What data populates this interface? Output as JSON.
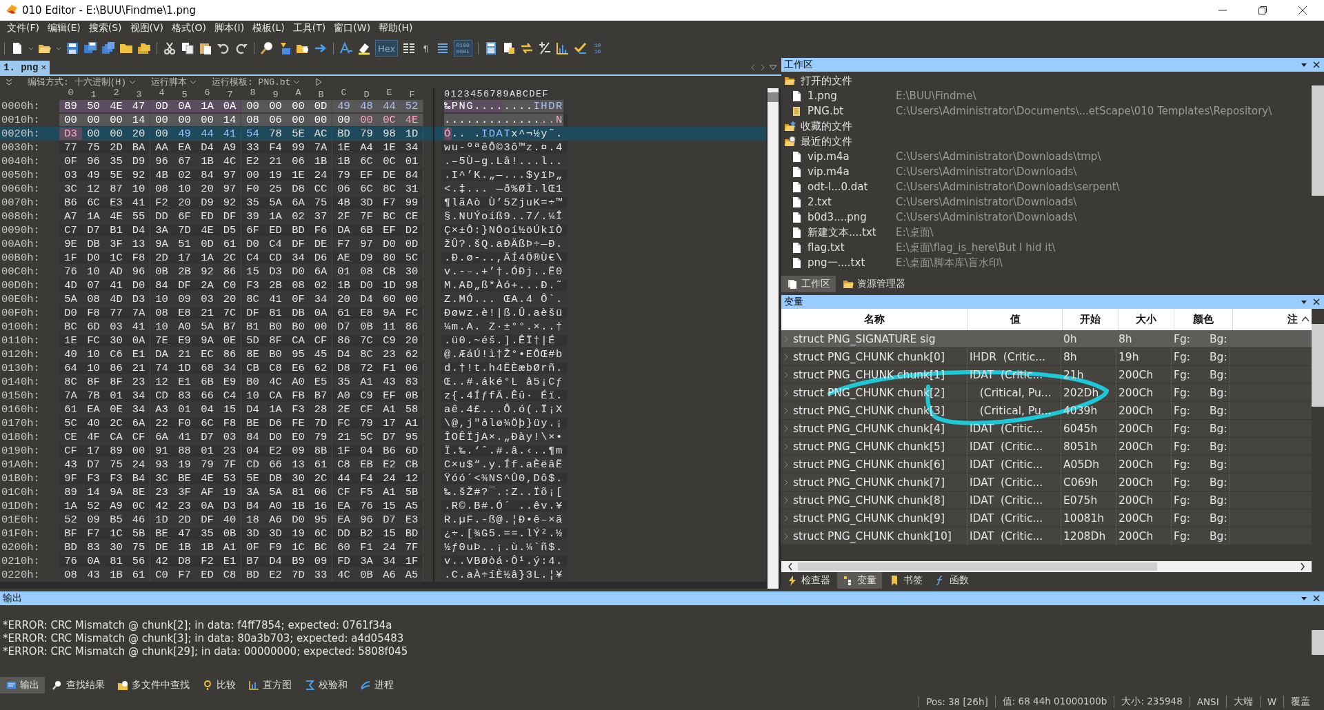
{
  "window": {
    "title": "010 Editor - E:\\BUU\\Findme\\1.png"
  },
  "menu": [
    "文件(F)",
    "编辑(E)",
    "搜索(S)",
    "视图(V)",
    "格式(O)",
    "脚本(I)",
    "模板(L)",
    "工具(T)",
    "窗口(W)",
    "帮助(H)"
  ],
  "toolbar": [
    {
      "kind": "sep"
    },
    {
      "kind": "new"
    },
    {
      "kind": "open"
    },
    {
      "kind": "save"
    },
    {
      "kind": "saveas"
    },
    {
      "kind": "saveall"
    },
    {
      "kind": "folder"
    },
    {
      "kind": "folders"
    },
    {
      "kind": "sep"
    },
    {
      "kind": "cut"
    },
    {
      "kind": "copy"
    },
    {
      "kind": "paste"
    },
    {
      "kind": "undo"
    },
    {
      "kind": "redo"
    },
    {
      "kind": "sep"
    },
    {
      "kind": "find"
    },
    {
      "kind": "replace"
    },
    {
      "kind": "findfiles"
    },
    {
      "kind": "goto"
    },
    {
      "kind": "sep"
    },
    {
      "kind": "font"
    },
    {
      "kind": "highlight"
    },
    {
      "kind": "text",
      "label": "Hex",
      "pressed": true
    },
    {
      "kind": "columns"
    },
    {
      "kind": "text",
      "label": "¶",
      "pressed": false
    },
    {
      "kind": "lines"
    },
    {
      "kind": "binary",
      "label": "0100 0001",
      "pressed": true
    },
    {
      "kind": "sep"
    },
    {
      "kind": "calc"
    },
    {
      "kind": "template"
    },
    {
      "kind": "swap"
    },
    {
      "kind": "plusminus"
    },
    {
      "kind": "histogram"
    },
    {
      "kind": "check"
    },
    {
      "kind": "base",
      "label": "10 16"
    }
  ],
  "editor": {
    "tab": {
      "label": "1. png",
      "close": "×",
      "selected": true
    },
    "options": [
      {
        "kind": "dropdown",
        "label": "编辑方式: 十六进制(H)"
      },
      {
        "kind": "dropdown",
        "label": "运行脚本"
      },
      {
        "kind": "dropdown",
        "label": "运行模板: PNG.bt"
      },
      {
        "kind": "play"
      }
    ],
    "columns": [
      "0",
      "1",
      "2",
      "3",
      "4",
      "5",
      "6",
      "7",
      "8",
      "9",
      "A",
      "B",
      "C",
      "D",
      "E",
      "F"
    ],
    "ascii_header": "0123456789ABCDEF",
    "rows": [
      {
        "offset": "0000h:",
        "cells": [
          {
            "text": "89",
            "kind": "sig"
          },
          {
            "text": "50",
            "kind": "sig"
          },
          {
            "text": "4E",
            "kind": "sig"
          },
          {
            "text": "47",
            "kind": "sig"
          },
          {
            "text": "0D",
            "kind": "sig"
          },
          {
            "text": "0A",
            "kind": "sig"
          },
          {
            "text": "1A",
            "kind": "sig"
          },
          {
            "text": "0A",
            "kind": "sig"
          },
          {
            "text": "00",
            "kind": "hdr"
          },
          {
            "text": "00",
            "kind": "hdr"
          },
          {
            "text": "00",
            "kind": "hdr"
          },
          {
            "text": "0D",
            "kind": "hdr"
          },
          {
            "text": "49",
            "kind": "type"
          },
          {
            "text": "48",
            "kind": "type"
          },
          {
            "text": "44",
            "kind": "type"
          },
          {
            "text": "52",
            "kind": "type"
          }
        ],
        "ascii": "‰PNG........IHDR",
        "selected": false
      },
      {
        "offset": "0010h:",
        "cells": [
          {
            "text": "00",
            "kind": "hdr"
          },
          {
            "text": "00",
            "kind": "hdr"
          },
          {
            "text": "00",
            "kind": "hdr"
          },
          {
            "text": "14",
            "kind": "hdr"
          },
          {
            "text": "00",
            "kind": "hdr"
          },
          {
            "text": "00",
            "kind": "hdr"
          },
          {
            "text": "00",
            "kind": "hdr"
          },
          {
            "text": "14",
            "kind": "hdr"
          },
          {
            "text": "08",
            "kind": "hdr"
          },
          {
            "text": "06",
            "kind": "hdr"
          },
          {
            "text": "00",
            "kind": "hdr"
          },
          {
            "text": "00",
            "kind": "hdr"
          },
          {
            "text": "00",
            "kind": "hdr"
          },
          {
            "text": "00",
            "kind": "crc"
          },
          {
            "text": "0C",
            "kind": "crc"
          },
          {
            "text": "4E",
            "kind": "crc"
          }
        ],
        "ascii": "...............N",
        "selected": false
      },
      {
        "offset": "0020h:",
        "cells": [
          {
            "text": "D3",
            "kind": "crc"
          },
          {
            "text": "00",
            "kind": "data"
          },
          {
            "text": "00",
            "kind": "data"
          },
          {
            "text": "20",
            "kind": "data"
          },
          {
            "text": "00",
            "kind": "data"
          },
          {
            "text": "49",
            "kind": "type"
          },
          {
            "text": "44",
            "kind": "type"
          },
          {
            "text": "41",
            "kind": "type"
          },
          {
            "text": "54",
            "kind": "type"
          },
          {
            "text": "78",
            "kind": "data"
          },
          {
            "text": "5E",
            "kind": "data"
          },
          {
            "text": "AC",
            "kind": "data"
          },
          {
            "text": "BD",
            "kind": "data"
          },
          {
            "text": "79",
            "kind": "data"
          },
          {
            "text": "98",
            "kind": "data"
          },
          {
            "text": "1D",
            "kind": "data"
          }
        ],
        "ascii": "Ó.. .IDATx^¬½y˜.",
        "selected": true
      },
      {
        "offset": "0030h:",
        "bytes": "77 75 2D BA AA EA D4 A9 33 F4 99 7A 1E A4 1E 34",
        "ascii": "wu-ºªêÔ©3ô™z.¤.4",
        "selected": false
      },
      {
        "offset": "0040h:",
        "bytes": "0F 96 35 D9 96 67 1B 4C E2 21 06 1B 1B 6C 0C 01",
        "ascii": ".–5Ù–g.Lâ!...l..",
        "selected": false
      },
      {
        "offset": "0050h:",
        "bytes": "03 49 5E 92 4B 02 84 97 00 19 1E 24 79 EF DE 84",
        "ascii": ".I^’K.„—...$yïÞ„",
        "selected": false
      },
      {
        "offset": "0060h:",
        "bytes": "3C 12 87 10 08 10 20 97 F0 25 D8 CC 06 6C 8C 31",
        "ascii": "<.‡... —ð%ØÌ.lŒ1",
        "selected": false
      },
      {
        "offset": "0070h:",
        "bytes": "B6 6C E3 41 F2 20 D9 92 35 5A 6A 75 4B 3D F7 99",
        "ascii": "¶lãAò Ù’5ZjuK=÷™",
        "selected": false
      },
      {
        "offset": "0080h:",
        "bytes": "A7 1A 4E 55 DD 6F ED DF 39 1A 02 37 2F 7F BC CE",
        "ascii": "§.NUÝoíß9..7/.¼Î",
        "selected": false
      },
      {
        "offset": "0090h:",
        "bytes": "C7 D7 B1 D4 3A 7D 4E D5 6F ED BD F6 DA 6B EF D2",
        "ascii": "Ç×±Ô:}NÕoí½öÚkïÒ",
        "selected": false
      },
      {
        "offset": "00A0h:",
        "bytes": "9E DB 3F 13 9A 51 0D 61 D0 C4 DF DE F7 97 D0 0D",
        "ascii": "žÛ?.šQ.aÐÄßÞ÷—Ð.",
        "selected": false
      },
      {
        "offset": "00B0h:",
        "bytes": "1F D0 1C F8 2D 17 1A 2C C4 CD 34 D6 AE D9 80 5C",
        "ascii": ".Ð.ø-..,ÄÍ4Ö®Ù€\\",
        "selected": false
      },
      {
        "offset": "00C0h:",
        "bytes": "76 10 AD 96 0B 2B 92 86 15 D3 D0 6A 01 08 CB 30",
        "ascii": "v.-–.+’†.ÓÐj..Ë0",
        "selected": false
      },
      {
        "offset": "00D0h:",
        "bytes": "4D 07 41 D0 84 DF 2A C0 F3 2B 08 02 1B D0 1D 98",
        "ascii": "M.AÐ„ß*Àó+...Ð.˜",
        "selected": false
      },
      {
        "offset": "00E0h:",
        "bytes": "5A 08 4D D3 10 09 03 20 8C 41 0F 34 20 D4 60 00",
        "ascii": "Z.MÓ... ŒA.4 Ô`.",
        "selected": false
      },
      {
        "offset": "00F0h:",
        "bytes": "D0 F8 77 7A 08 E8 21 7C DF 81 DB 0A 61 E8 9A FC",
        "ascii": "Ðøwz.è!|ß.Û.aèšü",
        "selected": false
      },
      {
        "offset": "0100h:",
        "bytes": "BC 6D 03 41 10 A0 5A B7 B1 B0 B0 00 D7 0B 11 86",
        "ascii": "¼m.A. Z·±°°.×..†",
        "selected": false
      },
      {
        "offset": "0110h:",
        "bytes": "1E FC 30 0A 7E E9 9A 0E 5D 8F CA CF 86 7C C9 20",
        "ascii": ".ü0.~éš.].ÊÏ†|É ",
        "selected": false
      },
      {
        "offset": "0120h:",
        "bytes": "40 10 C6 E1 DA 21 EC 86 8E B0 95 45 D4 8C 23 62",
        "ascii": "@.ÆáÚ!ì†Ž°•EÔŒ#b",
        "selected": false
      },
      {
        "offset": "0130h:",
        "bytes": "64 10 86 21 74 1D 68 34 CB C8 E6 62 D8 72 F1 06",
        "ascii": "d.†!t.h4ËÈæbØrñ.",
        "selected": false
      },
      {
        "offset": "0140h:",
        "bytes": "8C 8F 8F 23 12 E1 6B E9 B0 4C A0 E5 35 A1 43 83",
        "ascii": "Œ..#.áké°L å5¡Cƒ",
        "selected": false
      },
      {
        "offset": "0150h:",
        "bytes": "7A 7B 01 34 CD 83 66 C4 10 CA FB B7 A0 C9 EF 0B",
        "ascii": "z{.4ÍƒfÄ.Êû· Éï.",
        "selected": false
      },
      {
        "offset": "0160h:",
        "bytes": "61 EA 0E 34 A3 01 04 15 D4 1A F3 28 2E CF A1 58",
        "ascii": "aê.4£...Ô.ó(.Ï¡X",
        "selected": false
      },
      {
        "offset": "0170h:",
        "bytes": "5C 40 2C 6A 22 F0 6C F8 BE D6 FE 7D FC 79 17 A1",
        "ascii": "\\@,j\"ðlø¾Öþ}üy.¡",
        "selected": false
      },
      {
        "offset": "0180h:",
        "bytes": "CE 4F CA CF 6A 41 D7 03 84 D0 E0 79 21 5C D7 95",
        "ascii": "ÎOÊÏjA×.„Ðày!\\×•",
        "selected": false
      },
      {
        "offset": "0190h:",
        "bytes": "CF 17 89 00 91 88 01 23 04 E2 09 8B 1F 04 B6 6D",
        "ascii": "Ï.‰.‘ˆ.#.â.‹..¶m",
        "selected": false
      },
      {
        "offset": "01A0h:",
        "bytes": "43 D7 75 24 93 19 79 7F CD 66 13 61 C8 EB E2 CB",
        "ascii": "C×u$“.y.Íf.aÈëâË",
        "selected": false
      },
      {
        "offset": "01B0h:",
        "bytes": "9F F3 F3 B4 3C BE 4E 53 5E DB 30 2C 44 F4 24 12",
        "ascii": "Ÿóó´<¾NS^Û0,Dô$.",
        "selected": false
      },
      {
        "offset": "01C0h:",
        "bytes": "89 14 9A 8E 23 3F AF 19 3A 5A 81 06 CF F5 A1 5B",
        "ascii": "‰.šŽ#?¯.:Z..Ïõ¡[",
        "selected": false
      },
      {
        "offset": "01D0h:",
        "bytes": "1A 52 A9 0C 42 23 0A D3 B4 A0 1B 16 EA 76 15 A5",
        "ascii": ".R©.B#.Ó´ ..êv.¥",
        "selected": false
      },
      {
        "offset": "01E0h:",
        "bytes": "52 09 B5 46 1D 2D DF 40 18 A6 D0 95 EA 96 D7 E3",
        "ascii": "R.µF.-ß@.¦Ð•ê–×ã",
        "selected": false
      },
      {
        "offset": "01F0h:",
        "bytes": "BF F7 1C 5B BE 47 35 0B 3D 3D 19 6C DD B2 15 BD",
        "ascii": "¿÷.[¾G5.==.lÝ².½",
        "selected": false
      },
      {
        "offset": "0200h:",
        "bytes": "BD 83 30 75 DE 1B 1B A1 0F F9 1C BC 60 F1 24 7F",
        "ascii": "½ƒ0uÞ..¡.ù.¼`ñ$.",
        "selected": false
      },
      {
        "offset": "0210h:",
        "bytes": "76 0A 81 56 42 D8 F2 E1 B7 D4 B9 09 FD 3A 34 1F",
        "ascii": "v..VBØòá·Ô¹.ý:4.",
        "selected": false
      },
      {
        "offset": "0220h:",
        "bytes": "08 43 1B 61 C0 F7 ED C8 BD E2 7D 33 4C 0B A6 A5",
        "ascii": ".C.aÀ÷íÈ½â}3L.¦¥",
        "selected": false
      }
    ]
  },
  "workspace": {
    "title": "工作区",
    "tree": [
      {
        "label": "打开的文件",
        "kind": "open",
        "children": [
          {
            "label": "1.png",
            "path": "E:\\BUU\\Findme\\",
            "kind": "file"
          },
          {
            "label": "PNG.bt",
            "path": "C:\\Users\\Administrator\\Documents\\...etScape\\010 Templates\\Repository\\",
            "kind": "template"
          }
        ]
      },
      {
        "label": "收藏的文件",
        "kind": "favorites"
      },
      {
        "label": "最近的文件",
        "kind": "recent",
        "children": [
          {
            "label": "vip.m4a",
            "path": "C:\\Users\\Administrator\\Downloads\\tmp\\",
            "kind": "file"
          },
          {
            "label": "vip.m4a",
            "path": "C:\\Users\\Administrator\\Downloads\\",
            "kind": "file"
          },
          {
            "label": "odt-l...0.dat",
            "path": "C:\\Users\\Administrator\\Downloads\\serpent\\",
            "kind": "file"
          },
          {
            "label": "2.txt",
            "path": "C:\\Users\\Administrator\\Downloads\\",
            "kind": "file"
          },
          {
            "label": "b0d3....png",
            "path": "C:\\Users\\Administrator\\Downloads\\",
            "kind": "file"
          },
          {
            "label": "新建文本....txt",
            "path": "E:\\桌面\\",
            "kind": "file"
          },
          {
            "label": "flag.txt",
            "path": "E:\\桌面\\flag_is_here\\But I hid it\\",
            "kind": "file"
          },
          {
            "label": "png一....txt",
            "path": "E:\\桌面\\脚本库\\盲水印\\",
            "kind": "file"
          }
        ]
      }
    ],
    "tabs": [
      {
        "label": "工作区",
        "kind": "workspace",
        "selected": true
      },
      {
        "label": "资源管理器",
        "kind": "explorer",
        "selected": false
      }
    ]
  },
  "variables": {
    "title": "变量",
    "columns": [
      "名称",
      "值",
      "开始",
      "大小",
      "颜色",
      "注"
    ],
    "rows": [
      {
        "name": "struct PNG_SIGNATURE sig",
        "start": "0h",
        "size": "8h",
        "fg": "Fg:",
        "bg": "Bg:",
        "selected": true
      },
      {
        "name": "struct PNG_CHUNK chunk[0]",
        "value": "IHDR  (Critic...",
        "start": "8h",
        "size": "19h",
        "fg": "Fg:",
        "bg": "Bg:",
        "selected": false
      },
      {
        "name": "struct PNG_CHUNK chunk[1]",
        "value": "IDAT  (Critic...",
        "start": "21h",
        "size": "200Ch",
        "fg": "Fg:",
        "bg": "Bg:",
        "selected": false
      },
      {
        "name": "struct PNG_CHUNK chunk[2]",
        "value": "   (Critical, Pu...",
        "start": "202Dh",
        "size": "200Ch",
        "fg": "Fg:",
        "bg": "Bg:",
        "selected": false
      },
      {
        "name": "struct PNG_CHUNK chunk[3]",
        "value": "   (Critical, Pu...",
        "start": "4039h",
        "size": "200Ch",
        "fg": "Fg:",
        "bg": "Bg:",
        "selected": false
      },
      {
        "name": "struct PNG_CHUNK chunk[4]",
        "value": "IDAT  (Critic...",
        "start": "6045h",
        "size": "200Ch",
        "fg": "Fg:",
        "bg": "Bg:",
        "selected": false
      },
      {
        "name": "struct PNG_CHUNK chunk[5]",
        "value": "IDAT  (Critic...",
        "start": "8051h",
        "size": "200Ch",
        "fg": "Fg:",
        "bg": "Bg:",
        "selected": false
      },
      {
        "name": "struct PNG_CHUNK chunk[6]",
        "value": "IDAT  (Critic...",
        "start": "A05Dh",
        "size": "200Ch",
        "fg": "Fg:",
        "bg": "Bg:",
        "selected": false
      },
      {
        "name": "struct PNG_CHUNK chunk[7]",
        "value": "IDAT  (Critic...",
        "start": "C069h",
        "size": "200Ch",
        "fg": "Fg:",
        "bg": "Bg:",
        "selected": false
      },
      {
        "name": "struct PNG_CHUNK chunk[8]",
        "value": "IDAT  (Critic...",
        "start": "E075h",
        "size": "200Ch",
        "fg": "Fg:",
        "bg": "Bg:",
        "selected": false
      },
      {
        "name": "struct PNG_CHUNK chunk[9]",
        "value": "IDAT  (Critic...",
        "start": "10081h",
        "size": "200Ch",
        "fg": "Fg:",
        "bg": "Bg:",
        "selected": false
      },
      {
        "name": "struct PNG_CHUNK chunk[10]",
        "value": "IDAT  (Critic...",
        "start": "1208Dh",
        "size": "200Ch",
        "fg": "Fg:",
        "bg": "Bg:",
        "selected": false
      }
    ],
    "tabs": [
      {
        "label": "检查器",
        "kind": "inspector",
        "selected": false
      },
      {
        "label": "变量",
        "kind": "variables",
        "selected": true
      },
      {
        "label": "书签",
        "kind": "bookmarks",
        "selected": false
      },
      {
        "label": "函数",
        "kind": "functions",
        "selected": false
      }
    ]
  },
  "output": {
    "title": "输出",
    "lines": [
      "*ERROR: CRC Mismatch @ chunk[2]; in data: f4ff7854; expected: 0761f34a",
      "*ERROR: CRC Mismatch @ chunk[3]; in data: 80a3b703; expected: a4d05483",
      "*ERROR: CRC Mismatch @ chunk[29]; in data: 00000000; expected: 5808f045"
    ],
    "tabs": [
      {
        "label": "输出",
        "kind": "output",
        "selected": true
      },
      {
        "label": "查找结果",
        "kind": "find",
        "selected": false
      },
      {
        "label": "多文件中查找",
        "kind": "findfiles",
        "selected": false
      },
      {
        "label": "比较",
        "kind": "compare",
        "selected": false
      },
      {
        "label": "直方图",
        "kind": "histogram",
        "selected": false
      },
      {
        "label": "校验和",
        "kind": "checksum",
        "selected": false
      },
      {
        "label": "进程",
        "kind": "process",
        "selected": false
      }
    ]
  },
  "status_bar": [
    "Pos: 38 [26h]",
    "值: 68 44h 01000100b",
    "大小: 235948",
    "ANSI",
    "大端",
    "W",
    "覆盖"
  ]
}
